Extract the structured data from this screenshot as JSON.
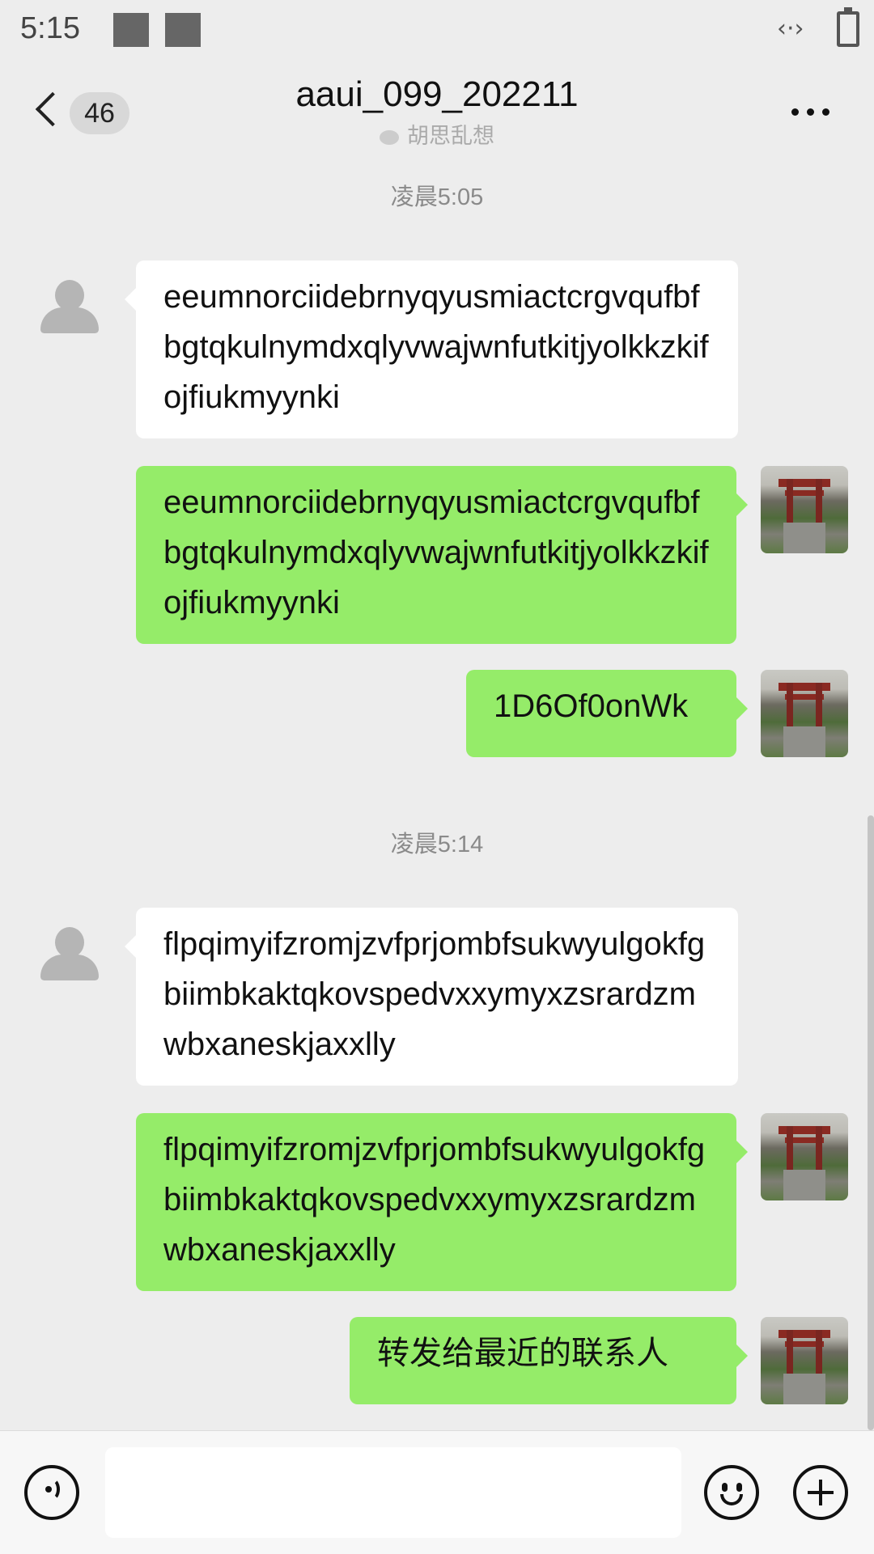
{
  "status_bar": {
    "time": "5:15"
  },
  "header": {
    "unread_count": "46",
    "title": "aaui_099_202211",
    "subtitle": "胡思乱想"
  },
  "messages": [
    {
      "type": "timestamp",
      "text": "凌晨5:05"
    },
    {
      "type": "in",
      "text": "eeumnorciidebrnyqyusmiactcrgvqufbfbgtqkulnymdxqlyvwajwnfutkitjyolkkzkifojfiukmyynki"
    },
    {
      "type": "out",
      "text": "eeumnorciidebrnyqyusmiactcrgvqufbfbgtqkulnymdxqlyvwajwnfutkitjyolkkzkifojfiukmyynki"
    },
    {
      "type": "out",
      "text": "1D6Of0onWk"
    },
    {
      "type": "timestamp",
      "text": "凌晨5:14"
    },
    {
      "type": "in",
      "text": "flpqimyifzromjzvfprjombfsukwyulgokfgbiimbkaktqkovspedvxxymyxzsrardzmwbxaneskjaxxlly"
    },
    {
      "type": "out",
      "text": "flpqimyifzromjzvfprjombfsukwyulgokfgbiimbkaktqkovspedvxxymyxzsrardzmwbxaneskjaxxlly"
    },
    {
      "type": "out",
      "text": "转发给最近的联系人"
    }
  ],
  "input_bar": {
    "text_value": ""
  },
  "colors": {
    "background": "#ededed",
    "incoming_bubble": "#ffffff",
    "outgoing_bubble": "#95ec69"
  }
}
